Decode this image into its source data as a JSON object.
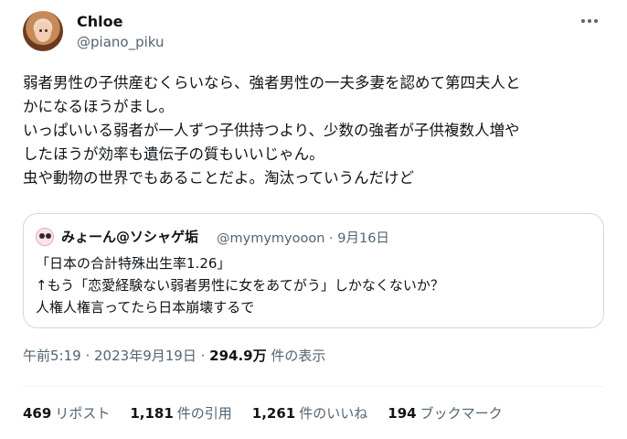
{
  "author": {
    "name": "Chloe",
    "handle": "@piano_piku"
  },
  "post": {
    "lines": [
      "弱者男性の子供産むくらいなら、強者男性の一夫多妻を認めて第四夫人と",
      "かになるほうがまし。",
      "いっぱいいる弱者が一人ずつ子供持つより、少数の強者が子供複数人増や",
      "したほうが効率も遺伝子の質もいいじゃん。",
      "虫や動物の世界でもあることだよ。淘汰っていうんだけど"
    ]
  },
  "quote": {
    "name": "みょーん@ソシャゲ垢",
    "handle": "@mymymyooon",
    "date": "9月16日",
    "lines": [
      "「日本の合計特殊出生率1.26」",
      "↑もう「恋愛経験ない弱者男性に女をあてがう」しかなくないか？",
      "人権人権言ってたら日本崩壊するで"
    ]
  },
  "meta": {
    "time": "午前5:19",
    "date": "2023年9月19日",
    "views_count": "294.9万",
    "views_label": "件の表示"
  },
  "stats": {
    "reposts_count": "469",
    "reposts_label": "リポスト",
    "quotes_count": "1,181",
    "quotes_label": "件の引用",
    "likes_count": "1,261",
    "likes_label": "件のいいね",
    "bookmarks_count": "194",
    "bookmarks_label": "ブックマーク"
  }
}
